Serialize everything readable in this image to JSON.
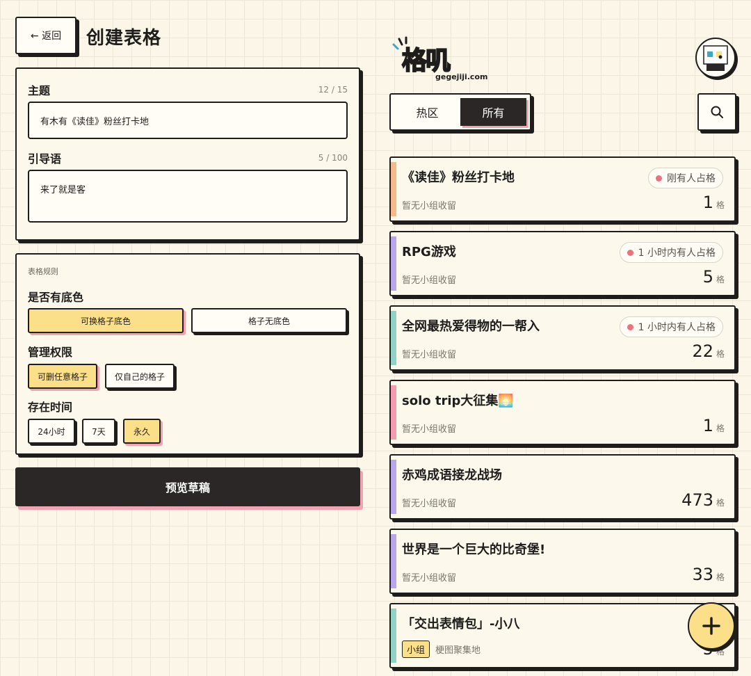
{
  "header": {
    "back_label": "← 返回",
    "title": "创建表格"
  },
  "form": {
    "topic": {
      "label": "主题",
      "count": "12 / 15",
      "value": "有木有《读佳》粉丝打卡地"
    },
    "intro": {
      "label": "引导语",
      "count": "5 / 100",
      "value": "来了就是客"
    }
  },
  "rules": {
    "section_label": "表格规则",
    "bg_color": {
      "label": "是否有底色",
      "options": [
        "可换格子底色",
        "格子无底色"
      ],
      "selected": "可换格子底色"
    },
    "permission": {
      "label": "管理权限",
      "options": [
        "可删任意格子",
        "仅自己的格子"
      ],
      "selected": "可删任意格子"
    },
    "duration": {
      "label": "存在时间",
      "options": [
        "24小时",
        "7天",
        "永久"
      ],
      "selected": "永久"
    }
  },
  "preview_label": "预览草稿",
  "brand": {
    "logo_text": "格叽",
    "logo_sub": "gegejiji.com"
  },
  "tabs": [
    {
      "label": "热区",
      "active": false
    },
    {
      "label": "所有",
      "active": true
    }
  ],
  "icons": {
    "search": "search-icon",
    "add": "plus-icon",
    "back": "arrow-left-icon"
  },
  "colors": {
    "accent_yellow": "#fce089",
    "accent_pink": "#f2a3b1",
    "dark": "#2a2726"
  },
  "posts": [
    {
      "title": "《读佳》粉丝打卡地",
      "subtitle": "暂无小组收留",
      "count": "1",
      "unit": "格",
      "badge": "刚有人占格",
      "bar_color": "#f6b98c"
    },
    {
      "title": "RPG游戏",
      "subtitle": "暂无小组收留",
      "count": "5",
      "unit": "格",
      "badge": "1 小时内有人占格",
      "bar_color": "#b7a6ea"
    },
    {
      "title": "全网最热爱得物的一帮入",
      "subtitle": "暂无小组收留",
      "count": "22",
      "unit": "格",
      "badge": "1 小时内有人占格",
      "bar_color": "#8fd3c4"
    },
    {
      "title": "solo trip大征集🌅",
      "subtitle": "暂无小组收留",
      "count": "1",
      "unit": "格",
      "badge": "",
      "bar_color": "#f49bb1"
    },
    {
      "title": "赤鸡成语接龙战场",
      "subtitle": "暂无小组收留",
      "count": "473",
      "unit": "格",
      "badge": "",
      "bar_color": "#b7a6ea"
    },
    {
      "title": "世界是一个巨大的比奇堡!",
      "subtitle": "暂无小组收留",
      "count": "33",
      "unit": "格",
      "badge": "",
      "bar_color": "#b7a6ea"
    },
    {
      "title": "「交出表情包」-小八",
      "group_tag": "小组",
      "subtitle": "梗图聚集地",
      "count": "5",
      "unit": "格",
      "badge": "",
      "bar_color": "#8fd3c4"
    }
  ]
}
